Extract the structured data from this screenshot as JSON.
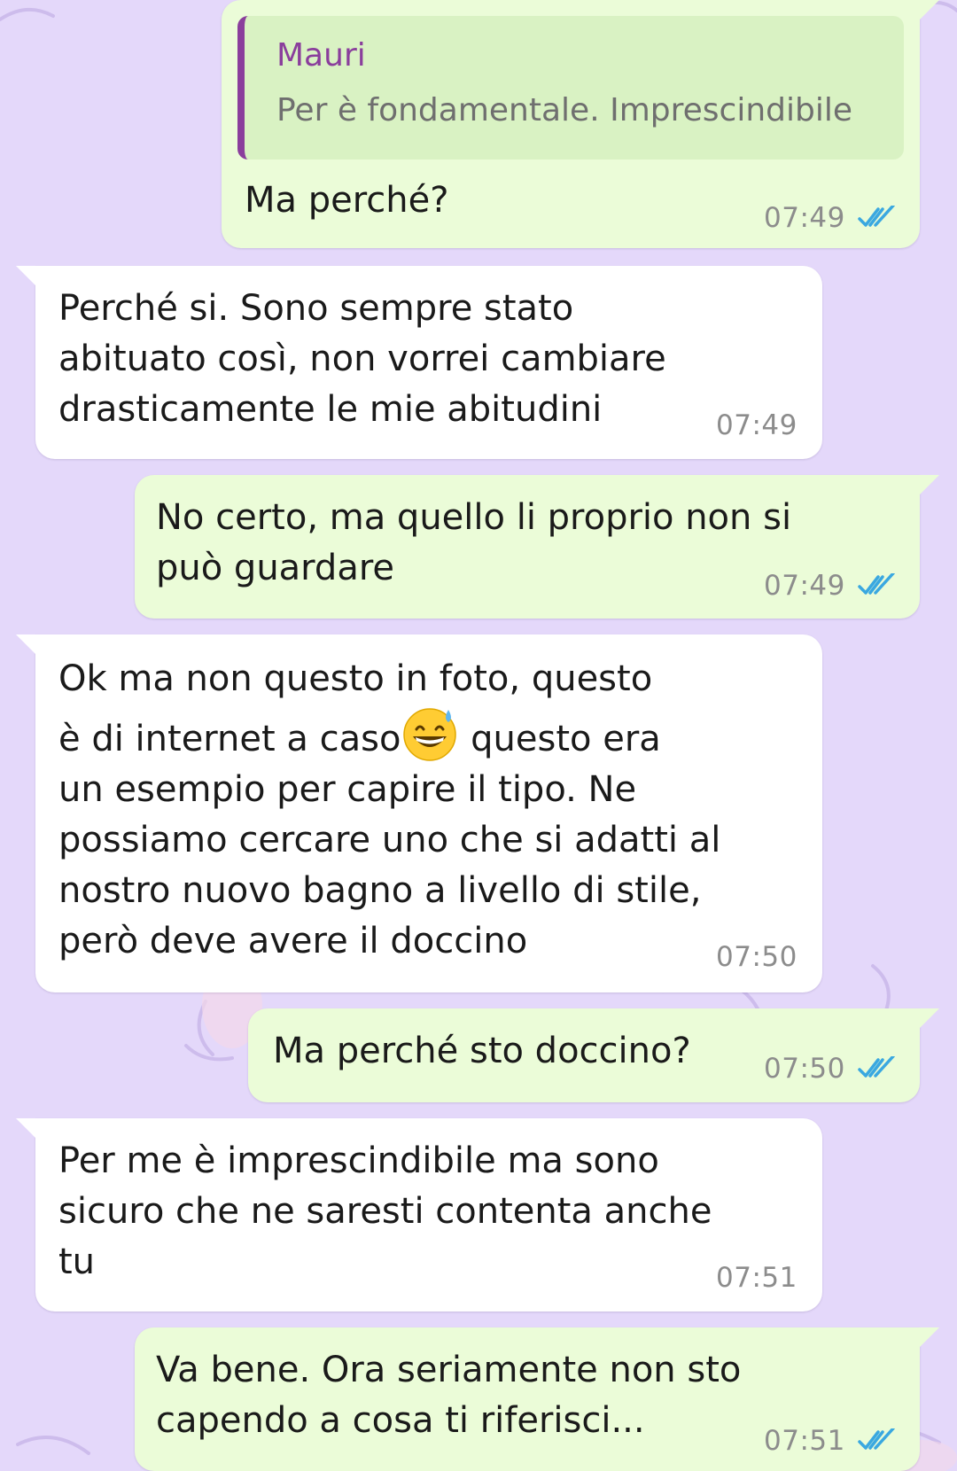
{
  "colors": {
    "wallpaper": "#e4d8fa",
    "outgoing_bubble": "#ebfcd8",
    "incoming_bubble": "#ffffff",
    "quote_accent": "#8a3e9c",
    "read_ticks": "#3aa8e0",
    "timestamp": "#8c8c8c"
  },
  "messages": [
    {
      "direction": "outgoing",
      "quote": {
        "author": "Mauri",
        "text": "Per è fondamentale. Imprescindibile"
      },
      "text": "Ma perché?",
      "time": "07:49",
      "status_icon": "double-check-read-icon"
    },
    {
      "direction": "incoming",
      "text": "Perché si. Sono sempre stato\nabituato così, non vorrei cambiare\ndrasticamente le mie abitudini",
      "time": "07:49"
    },
    {
      "direction": "outgoing",
      "text": "No certo, ma quello li proprio non si\npuò guardare",
      "time": "07:49",
      "status_icon": "double-check-read-icon"
    },
    {
      "direction": "incoming",
      "text_before_emoji": "Ok ma non questo in foto, questo\nè di internet a caso",
      "emoji": "grinning-face-with-sweat-emoji",
      "text_after_emoji": " questo era\nun esempio per capire il tipo. Ne\npossiamo cercare uno che si adatti al\nnostro nuovo bagno a livello di stile,\nperò deve avere il doccino",
      "time": "07:50"
    },
    {
      "direction": "outgoing",
      "text": "Ma perché sto doccino?",
      "time": "07:50",
      "status_icon": "double-check-read-icon"
    },
    {
      "direction": "incoming",
      "text": "Per me è imprescindibile ma sono\nsicuro che ne saresti contenta anche\ntu",
      "time": "07:51"
    },
    {
      "direction": "outgoing",
      "text": "Va bene. Ora seriamente non sto\ncapendo a cosa ti riferisci...",
      "time": "07:51",
      "status_icon": "double-check-read-icon"
    }
  ]
}
